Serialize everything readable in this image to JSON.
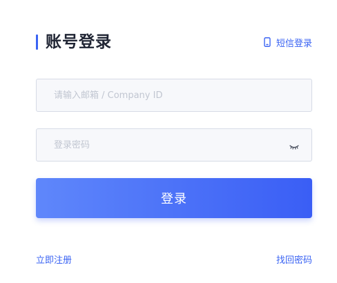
{
  "header": {
    "title": "账号登录",
    "sms_login_label": "短信登录",
    "sms_icon": "mobile-phone-icon"
  },
  "form": {
    "account": {
      "placeholder": "请输入邮箱 / Company ID",
      "value": ""
    },
    "password": {
      "placeholder": "登录密码",
      "value": "",
      "toggle_icon": "eye-closed-icon"
    },
    "submit_label": "登录"
  },
  "footer": {
    "register_label": "立即注册",
    "forgot_label": "找回密码"
  },
  "colors": {
    "accent": "#3a63f3",
    "button_gradient_start": "#5f87fb",
    "button_gradient_end": "#3a5ef5",
    "input_background": "#f7f8fb",
    "input_border": "#d6dbe6",
    "title_text": "#1f2433"
  }
}
